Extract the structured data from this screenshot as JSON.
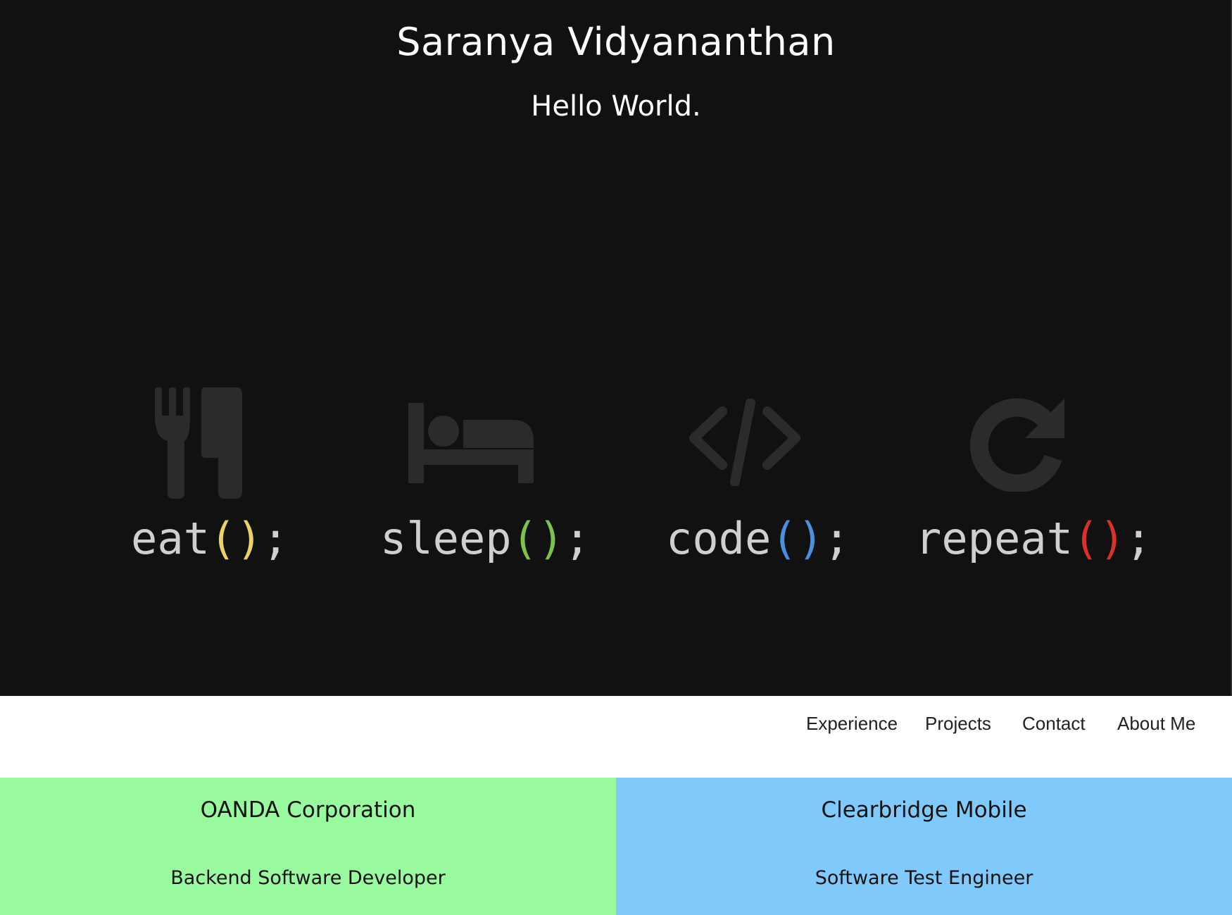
{
  "hero": {
    "name": "Saranya Vidyananthan",
    "greeting": "Hello World.",
    "background_color": "#111111",
    "motif": [
      {
        "icon": "fork-knife-icon",
        "word": "eat",
        "open": "(",
        "close": ")",
        "end": ";",
        "paren_color": "#e9d26a"
      },
      {
        "icon": "bed-icon",
        "word": "sleep",
        "open": "(",
        "close": ")",
        "end": ";",
        "paren_color": "#7cc24d"
      },
      {
        "icon": "code-icon",
        "word": "code",
        "open": "(",
        "close": ")",
        "end": ";",
        "paren_color": "#4a90e2"
      },
      {
        "icon": "refresh-icon",
        "word": "repeat",
        "open": "(",
        "close": ")",
        "end": ";",
        "paren_color": "#d9312b"
      }
    ]
  },
  "nav": {
    "items": [
      {
        "label": "Experience"
      },
      {
        "label": "Projects"
      },
      {
        "label": "Contact"
      },
      {
        "label": "About Me"
      }
    ]
  },
  "experience": [
    {
      "company": "OANDA Corporation",
      "role": "Backend Software Developer",
      "color": "#98f99e"
    },
    {
      "company": "Clearbridge Mobile",
      "role": "Software Test Engineer",
      "color": "#80c9fb"
    }
  ]
}
